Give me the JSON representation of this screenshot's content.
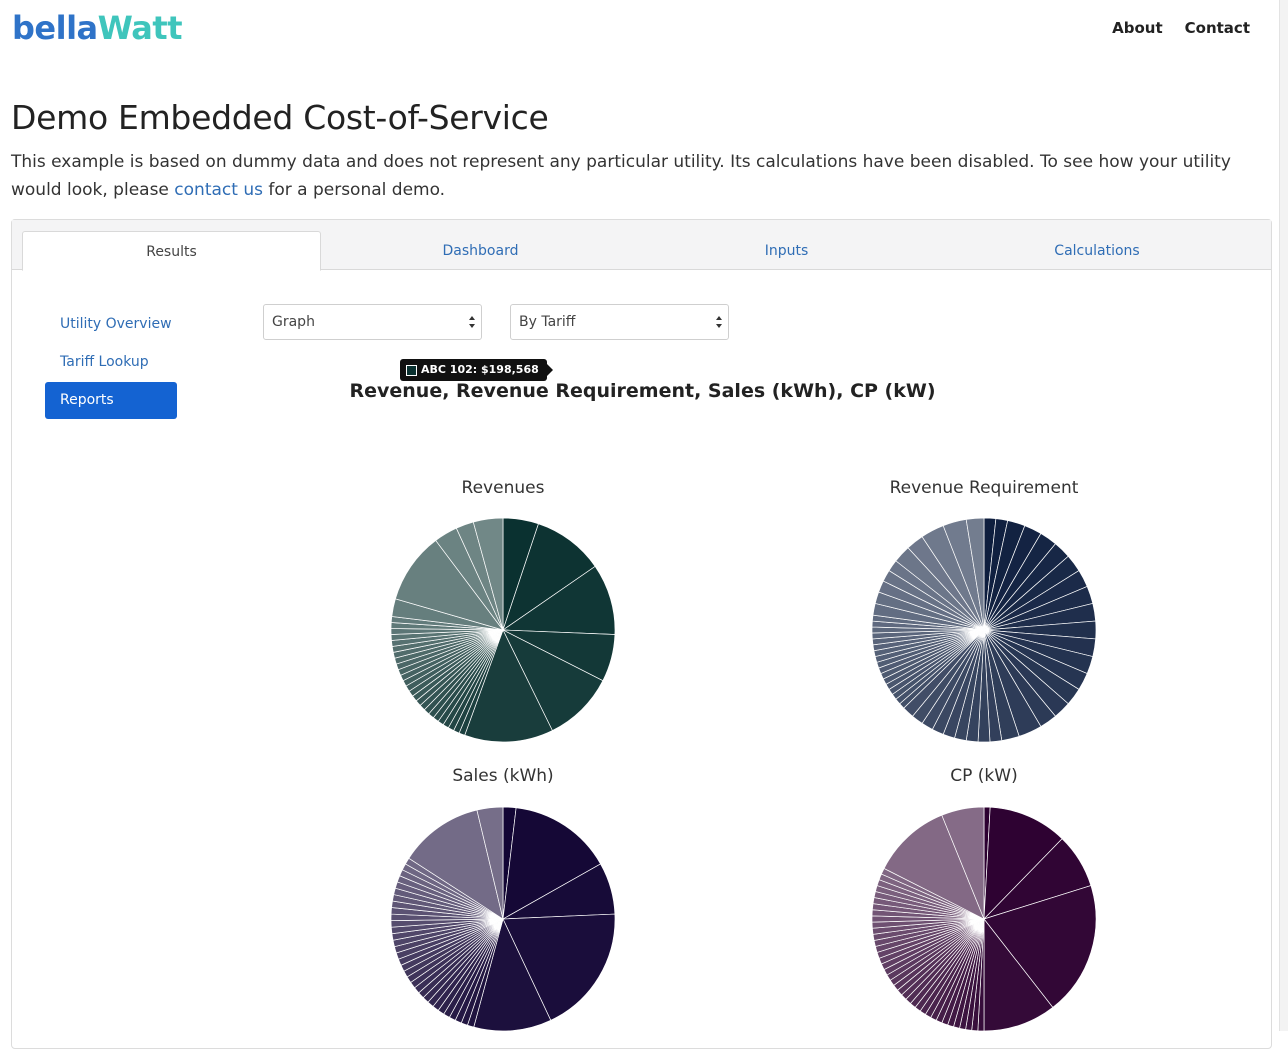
{
  "header": {
    "logo_part1": "bella",
    "logo_part2": "Watt",
    "nav": [
      {
        "label": "About"
      },
      {
        "label": "Contact"
      }
    ]
  },
  "page": {
    "title": "Demo Embedded Cost-of-Service",
    "intro_before": "This example is based on dummy data and does not represent any particular utility. Its calculations have been disabled. To see how your utility would look, please ",
    "intro_link": "contact us",
    "intro_after": " for a personal demo."
  },
  "tabs": [
    {
      "label": "Results",
      "active": true
    },
    {
      "label": "Dashboard",
      "active": false
    },
    {
      "label": "Inputs",
      "active": false
    },
    {
      "label": "Calculations",
      "active": false
    }
  ],
  "sidebar": {
    "items": [
      {
        "label": "Utility Overview",
        "active": false
      },
      {
        "label": "Tariff Lookup",
        "active": false
      },
      {
        "label": "Reports",
        "active": true
      }
    ]
  },
  "controls": {
    "view_select": "Graph",
    "group_select": "By Tariff"
  },
  "chart_data": [
    {
      "type": "pie",
      "title": "Revenues",
      "base_color": "#0a3130",
      "values": [
        6.0,
        12.0,
        12.0,
        8.0,
        12.0,
        15.0,
        1.0,
        1.0,
        1.0,
        1.0,
        1.0,
        1.0,
        1.0,
        1.0,
        1.0,
        1.0,
        1.0,
        1.0,
        1.0,
        1.0,
        1.0,
        1.0,
        1.0,
        1.0,
        1.0,
        1.0,
        1.0,
        1.0,
        1.0,
        1.0,
        1.0,
        3.0,
        12.0,
        4.0,
        3.0,
        5.0
      ],
      "tooltip": {
        "label": "ABC 102: $198,568"
      }
    },
    {
      "type": "pie",
      "title": "Revenue Requirement",
      "base_color": "#0e1e3e",
      "values": [
        2,
        2,
        3,
        3,
        3,
        3,
        3,
        3,
        3,
        3,
        3,
        3,
        3,
        3,
        3,
        3,
        3,
        4,
        3,
        2,
        2,
        2,
        2,
        2,
        2,
        2,
        2,
        2,
        1,
        1,
        1,
        1,
        1,
        1,
        1,
        1,
        1,
        1,
        1,
        1,
        1,
        1,
        1,
        1,
        1,
        2,
        2,
        2,
        2,
        2,
        3,
        3,
        4,
        4,
        3
      ]
    },
    {
      "type": "pie",
      "title": "Sales (kWh)",
      "base_color": "#120534",
      "values": [
        2.0,
        16.0,
        8.0,
        20.0,
        12.0,
        1.0,
        1.0,
        1.0,
        1.0,
        1.0,
        1.0,
        1.0,
        1.0,
        1.0,
        1.0,
        1.0,
        1.0,
        1.0,
        1.0,
        1.0,
        1.0,
        1.0,
        1.0,
        1.0,
        1.0,
        1.0,
        1.0,
        1.0,
        1.0,
        1.0,
        1.0,
        1.0,
        1.0,
        1.0,
        1.0,
        1.0,
        1.0,
        13.0,
        4.0
      ]
    },
    {
      "type": "pie",
      "title": "CP (kW)",
      "base_color": "#2c0030",
      "values": [
        1.0,
        13.0,
        9.0,
        22.0,
        12.0,
        1.0,
        1.0,
        1.0,
        1.0,
        1.0,
        1.0,
        1.0,
        1.0,
        1.0,
        1.0,
        1.0,
        1.0,
        1.0,
        1.0,
        1.0,
        1.0,
        1.0,
        1.0,
        1.0,
        1.0,
        1.0,
        1.0,
        1.0,
        1.0,
        1.0,
        1.0,
        1.0,
        1.0,
        1.0,
        1.0,
        1.0,
        1.0,
        1.0,
        1.0,
        1.0,
        1.0,
        1.0,
        13.0,
        7.0
      ]
    }
  ],
  "chart_title": "Revenue, Revenue Requirement, Sales (kWh), CP (kW)"
}
